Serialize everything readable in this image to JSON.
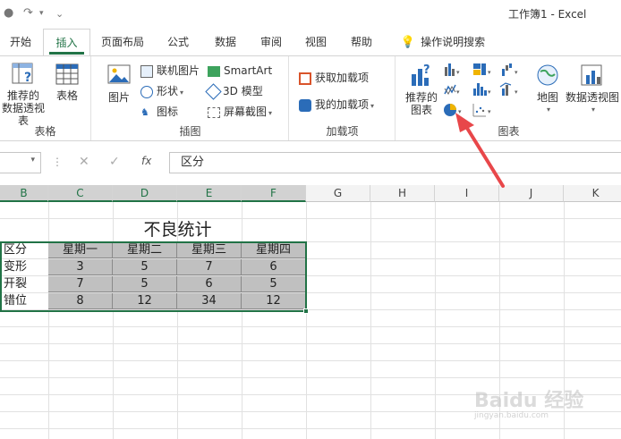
{
  "titlebar": {
    "doc_title": "工作簿1  -  Excel"
  },
  "tabs": [
    {
      "label": "开始"
    },
    {
      "label": "插入",
      "active": true
    },
    {
      "label": "页面布局"
    },
    {
      "label": "公式"
    },
    {
      "label": "数据"
    },
    {
      "label": "审阅"
    },
    {
      "label": "视图"
    },
    {
      "label": "帮助"
    },
    {
      "label": "操作说明搜索"
    }
  ],
  "ribbon": {
    "tables": {
      "pivot_label_1": "推荐的",
      "pivot_label_2": "数据透视表",
      "table_label": "表格",
      "group_label": "表格"
    },
    "illustrations": {
      "picture_label": "图片",
      "online_picture": "联机图片",
      "shapes": "形状",
      "icons": "图标",
      "smartart": "SmartArt",
      "model_3d": "3D 模型",
      "screenshot": "屏幕截图",
      "group_label": "插图"
    },
    "addins": {
      "get_addins": "获取加载项",
      "my_addins": "我的加载项",
      "group_label": "加载项"
    },
    "charts": {
      "recommended_1": "推荐的",
      "recommended_2": "图表",
      "maps": "地图",
      "pivot_chart": "数据透视图",
      "group_label": "图表"
    }
  },
  "formula_bar": {
    "value": "区分",
    "fx": "fx"
  },
  "grid": {
    "columns": [
      "B",
      "C",
      "D",
      "E",
      "F",
      "G",
      "H",
      "I",
      "J",
      "K"
    ],
    "table_title": "不良统计",
    "header_row": [
      "区分",
      "星期一",
      "星期二",
      "星期三",
      "星期四"
    ],
    "rows": [
      [
        "变形",
        "3",
        "5",
        "7",
        "6"
      ],
      [
        "开裂",
        "7",
        "5",
        "6",
        "5"
      ],
      [
        "错位",
        "8",
        "12",
        "34",
        "12"
      ]
    ]
  },
  "watermark": {
    "text": "Baidu 经验",
    "sub": "jingyan.baidu.com"
  },
  "colors": {
    "excel_green": "#217346",
    "cell_fill": "#c0c0c0",
    "arrow": "#e8474a"
  }
}
